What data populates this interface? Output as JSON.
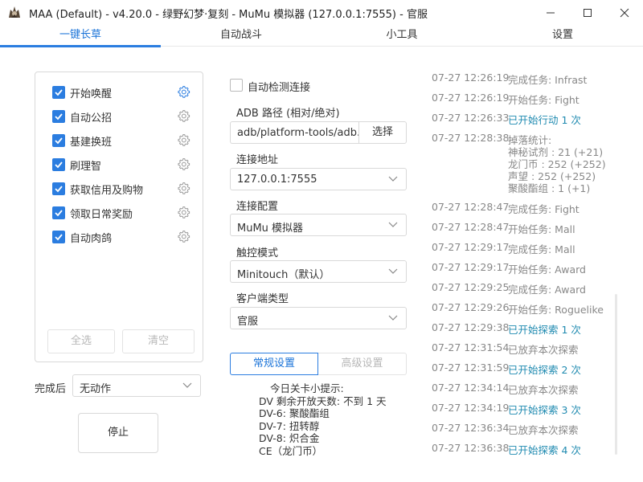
{
  "window": {
    "title": "MAA (Default) - v4.20.0 - 绿野幻梦·复刻 - MuMu 模拟器 (127.0.0.1:7555) - 官服"
  },
  "tabs": [
    {
      "label": "一键长草",
      "active": true
    },
    {
      "label": "自动战斗",
      "active": false
    },
    {
      "label": "小工具",
      "active": false
    },
    {
      "label": "设置",
      "active": false
    }
  ],
  "tasks": [
    {
      "label": "开始唤醒",
      "checked": true,
      "gear_active": true
    },
    {
      "label": "自动公招",
      "checked": true
    },
    {
      "label": "基建换班",
      "checked": true
    },
    {
      "label": "刷理智",
      "checked": true
    },
    {
      "label": "获取信用及购物",
      "checked": true
    },
    {
      "label": "领取日常奖励",
      "checked": true
    },
    {
      "label": "自动肉鸽",
      "checked": true
    }
  ],
  "task_buttons": {
    "select_all": "全选",
    "clear": "清空"
  },
  "after_completion": {
    "label": "完成后",
    "value": "无动作"
  },
  "stop_button": "停止",
  "connection": {
    "auto_detect_label": "自动检测连接",
    "adb_path_label": "ADB 路径 (相对/绝对)",
    "adb_path_value": "adb/platform-tools/adb.exe",
    "browse_button": "选择",
    "address_label": "连接地址",
    "address_value": "127.0.0.1:7555",
    "config_label": "连接配置",
    "config_value": "MuMu 模拟器",
    "touch_label": "触控模式",
    "touch_value": "Minitouch（默认）",
    "client_label": "客户端类型",
    "client_value": "官服"
  },
  "settings_tabs": {
    "normal": "常规设置",
    "advanced": "高级设置"
  },
  "tips": [
    "今日关卡小提示:",
    "DV 剩余开放天数: 不到 1 天",
    "DV-6: 聚酸酯组",
    "DV-7: 扭转醇",
    "DV-8: 炽合金",
    "CE（龙门币）"
  ],
  "log": [
    {
      "time": "07-27  12:26:19",
      "msg": "完成任务: Infrast",
      "blue": false
    },
    {
      "time": "07-27  12:26:19",
      "msg": "开始任务: Fight",
      "blue": false
    },
    {
      "time": "07-27  12:26:33",
      "msg": "已开始行动 1 次",
      "blue": true
    },
    {
      "time": "07-27  12:28:38",
      "msg": "掉落统计:",
      "blue": false,
      "sub": [
        "神秘试剂 : 21 (+21)",
        "龙门币 : 252 (+252)",
        "声望 : 252 (+252)",
        "聚酸酯组 : 1 (+1)"
      ]
    },
    {
      "time": "07-27  12:28:47",
      "msg": "完成任务: Fight",
      "blue": false
    },
    {
      "time": "07-27  12:28:47",
      "msg": "开始任务: Mall",
      "blue": false
    },
    {
      "time": "07-27  12:29:17",
      "msg": "完成任务: Mall",
      "blue": false
    },
    {
      "time": "07-27  12:29:17",
      "msg": "开始任务: Award",
      "blue": false
    },
    {
      "time": "07-27  12:29:25",
      "msg": "完成任务: Award",
      "blue": false
    },
    {
      "time": "07-27  12:29:26",
      "msg": "开始任务: Roguelike",
      "blue": false
    },
    {
      "time": "07-27  12:29:38",
      "msg": "已开始探索 1 次",
      "blue": true
    },
    {
      "time": "07-27  12:31:54",
      "msg": "已放弃本次探索",
      "blue": false
    },
    {
      "time": "07-27  12:31:59",
      "msg": "已开始探索 2 次",
      "blue": true
    },
    {
      "time": "07-27  12:34:14",
      "msg": "已放弃本次探索",
      "blue": false
    },
    {
      "time": "07-27  12:34:19",
      "msg": "已开始探索 3 次",
      "blue": true
    },
    {
      "time": "07-27  12:36:34",
      "msg": "已放弃本次探索",
      "blue": false
    },
    {
      "time": "07-27  12:36:38",
      "msg": "已开始探索 4 次",
      "blue": true
    }
  ],
  "colors": {
    "accent": "#2b7de0",
    "log_blue": "#1f8ab0",
    "log_gray": "#888888"
  }
}
